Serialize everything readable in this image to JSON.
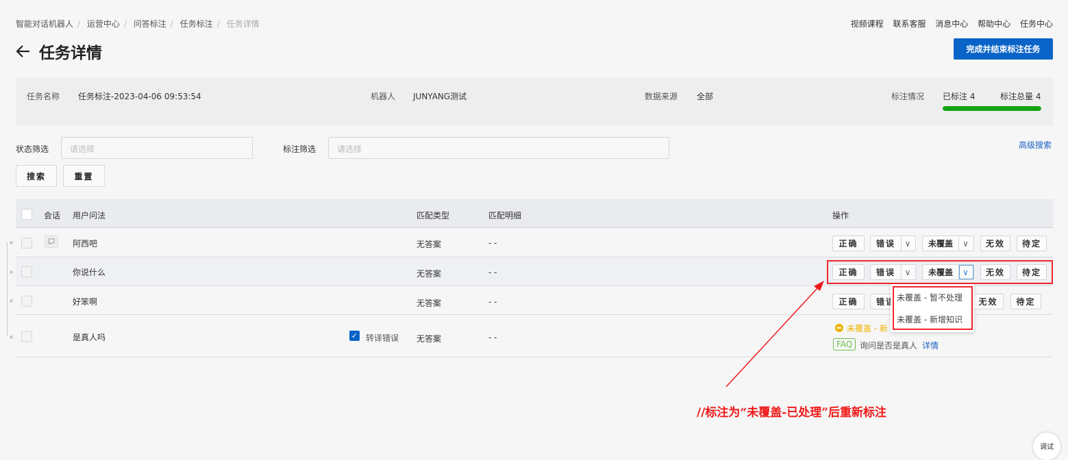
{
  "breadcrumb": [
    "智能对话机器人",
    "运营中心",
    "问答标注",
    "任务标注",
    "任务详情"
  ],
  "top_links": [
    "视频课程",
    "联系客服",
    "消息中心",
    "帮助中心",
    "任务中心"
  ],
  "page_title": "任务详情",
  "finish_button": "完成并结束标注任务",
  "info": {
    "task_name_label": "任务名称",
    "task_name": "任务标注-2023-04-06 09:53:54",
    "robot_label": "机器人",
    "robot": "JUNYANG测试",
    "source_label": "数据来源",
    "source": "全部",
    "status_label": "标注情况",
    "labeled": "已标注 4",
    "total": "标注总量 4",
    "progress": 1.0
  },
  "filters": {
    "status_label": "状态筛选",
    "status_placeholder": "请选择",
    "mark_label": "标注筛选",
    "mark_placeholder": "请选择",
    "advanced": "高级搜索",
    "search": "搜索",
    "reset": "重置"
  },
  "table": {
    "headers": {
      "session": "会话",
      "question": "用户问法",
      "match_type": "匹配类型",
      "match_detail": "匹配明细",
      "ops": "操作"
    },
    "rows": [
      {
        "question": "阿西吧",
        "match_type": "无答案",
        "match_detail": "- -"
      },
      {
        "question": "你说什么",
        "match_type": "无答案",
        "match_detail": "- -"
      },
      {
        "question": "好笨啊",
        "match_type": "无答案",
        "match_detail": "- -"
      },
      {
        "question": "是真人吗",
        "transcribe_error": "转译错误",
        "match_type": "无答案",
        "match_detail": "- -",
        "status": "未覆盖 - 新",
        "faq_tag": "FAQ",
        "faq_text": "询问是否是真人",
        "detail_link": "详情"
      }
    ],
    "actions": {
      "correct": "正确",
      "wrong": "错误",
      "uncovered": "未覆盖",
      "invalid": "无效",
      "pending": "待定",
      "wrong_partial": "错误"
    }
  },
  "dropdown": [
    "未覆盖 - 暂不处理",
    "未覆盖 - 新增知识"
  ],
  "annotation": "//标注为“未覆盖-已处理”后重新标注",
  "float_button": "调试",
  "colors": {
    "primary": "#0a64c8",
    "progress": "#12a40f",
    "annotation": "#f01818",
    "warning": "#f0b400",
    "faq": "#6ac14a"
  }
}
